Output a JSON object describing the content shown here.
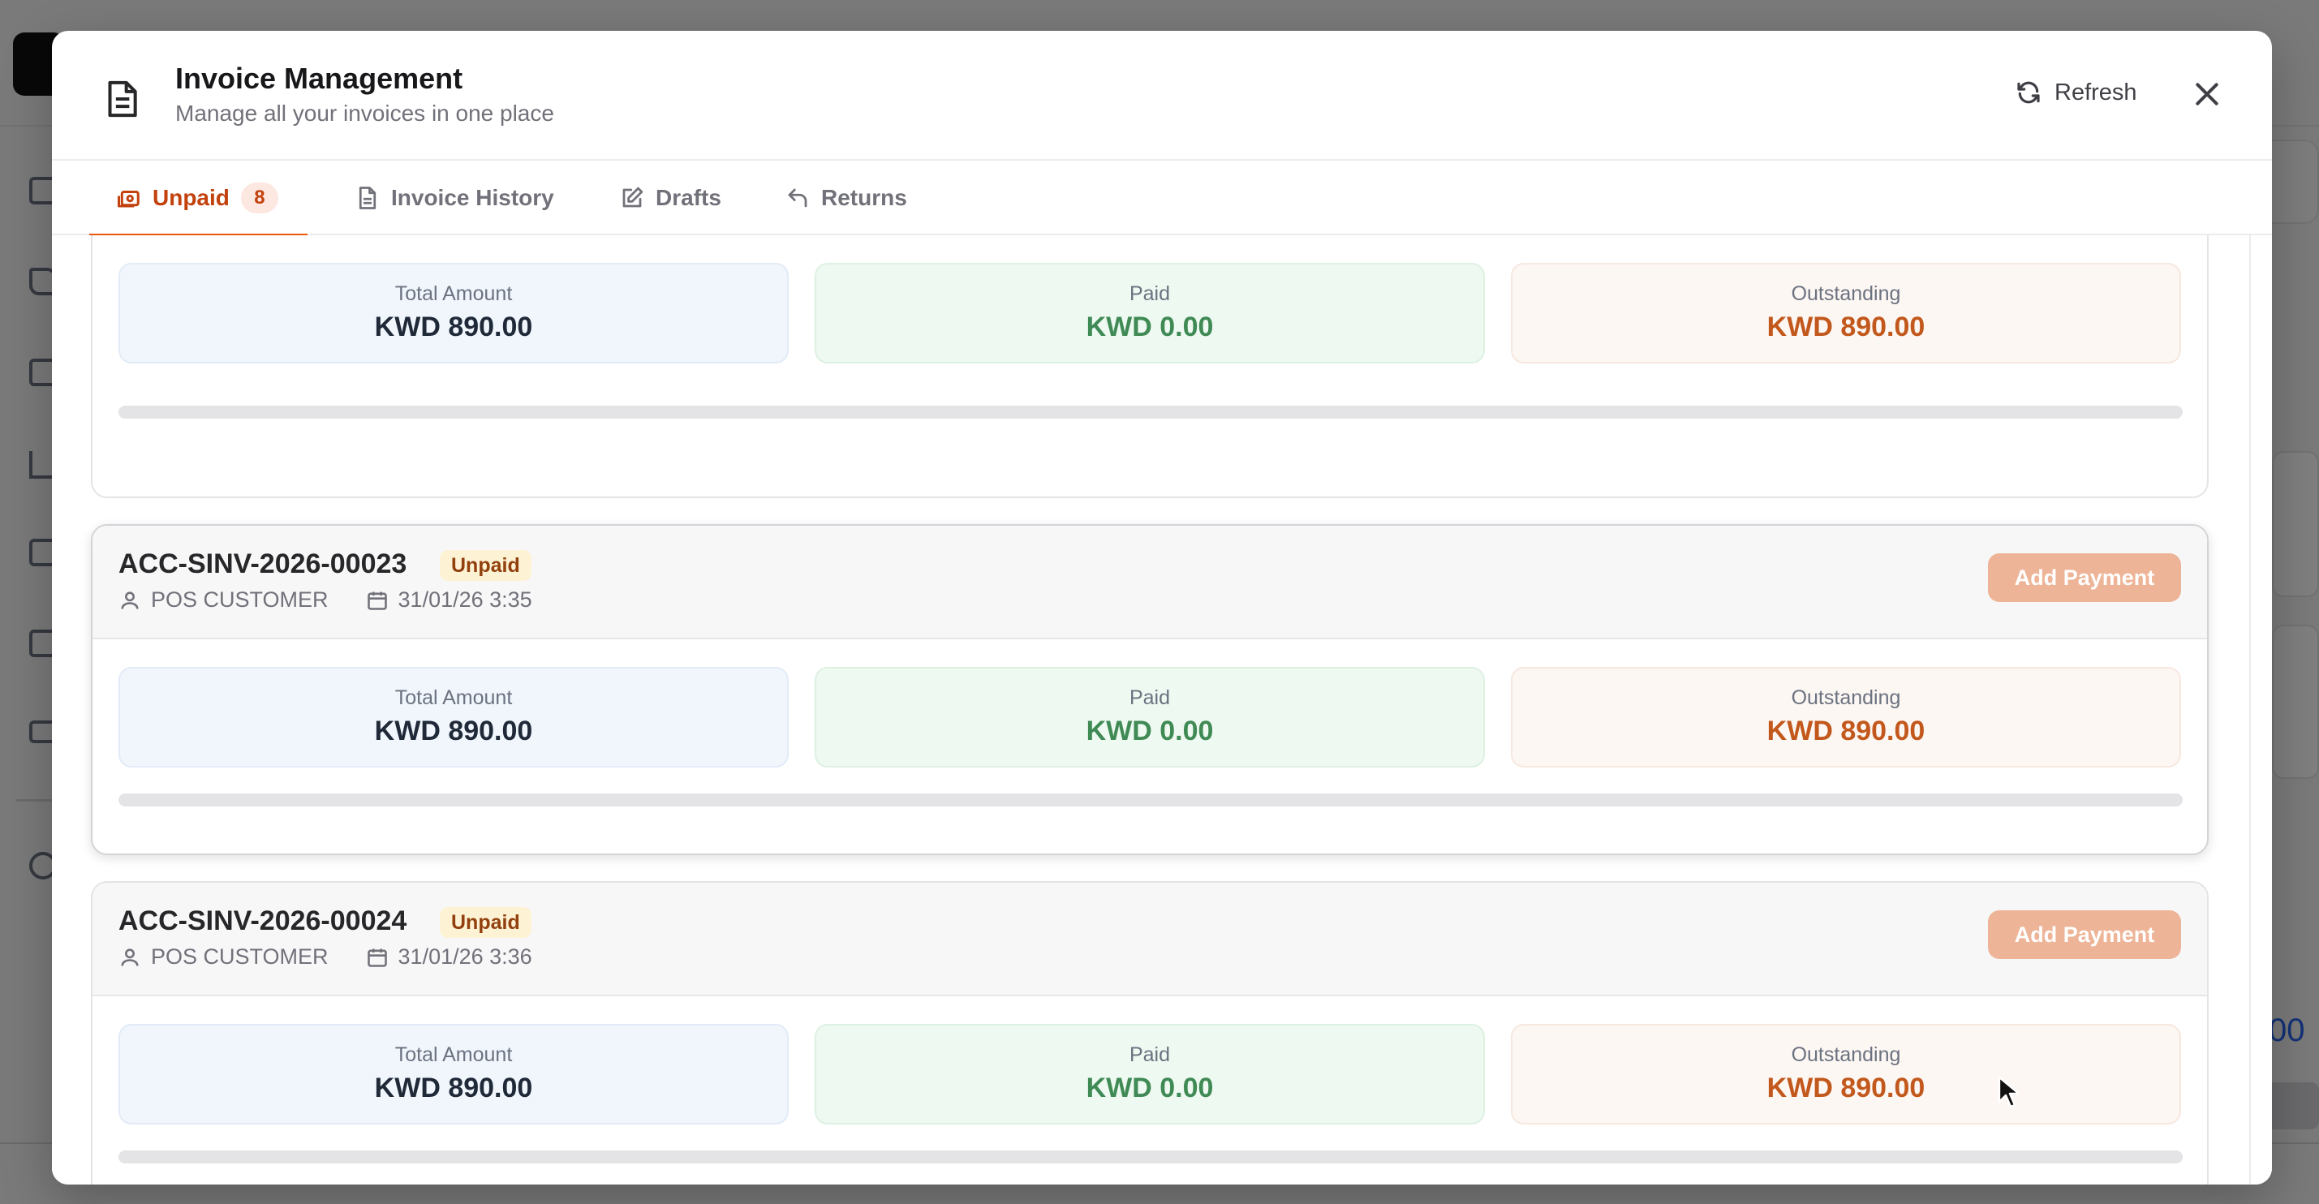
{
  "modal": {
    "title": "Invoice Management",
    "subtitle": "Manage all your invoices in one place",
    "refresh_label": "Refresh"
  },
  "tabs": [
    {
      "label": "Unpaid",
      "badge": "8",
      "icon": "unpaid-icon",
      "active": true
    },
    {
      "label": "Invoice History",
      "icon": "document-icon",
      "active": false
    },
    {
      "label": "Drafts",
      "icon": "edit-icon",
      "active": false
    },
    {
      "label": "Returns",
      "icon": "return-arrow-icon",
      "active": false
    }
  ],
  "stat_labels": {
    "total": "Total Amount",
    "paid": "Paid",
    "outstanding": "Outstanding"
  },
  "invoices": [
    {
      "total": "KWD 890.00",
      "paid": "KWD 0.00",
      "outstanding": "KWD 890.00",
      "paid_fraction": 0
    },
    {
      "id": "ACC-SINV-2026-00023",
      "status": "Unpaid",
      "customer": "POS CUSTOMER",
      "datetime": "31/01/26 3:35",
      "action": "Add Payment",
      "total": "KWD 890.00",
      "paid": "KWD 0.00",
      "outstanding": "KWD 890.00",
      "paid_fraction": 0
    },
    {
      "id": "ACC-SINV-2026-00024",
      "status": "Unpaid",
      "customer": "POS CUSTOMER",
      "datetime": "31/01/26 3:36",
      "action": "Add Payment",
      "total": "KWD 890.00",
      "paid": "KWD 0.00",
      "outstanding": "KWD 890.00",
      "paid_fraction": 0
    }
  ],
  "colors": {
    "accent": "#ea580c",
    "status_unpaid_bg": "#fdf3d4",
    "add_payment_bg": "#eeb497",
    "paid_text": "#3f8a55",
    "outstanding_text": "#c2581c"
  }
}
